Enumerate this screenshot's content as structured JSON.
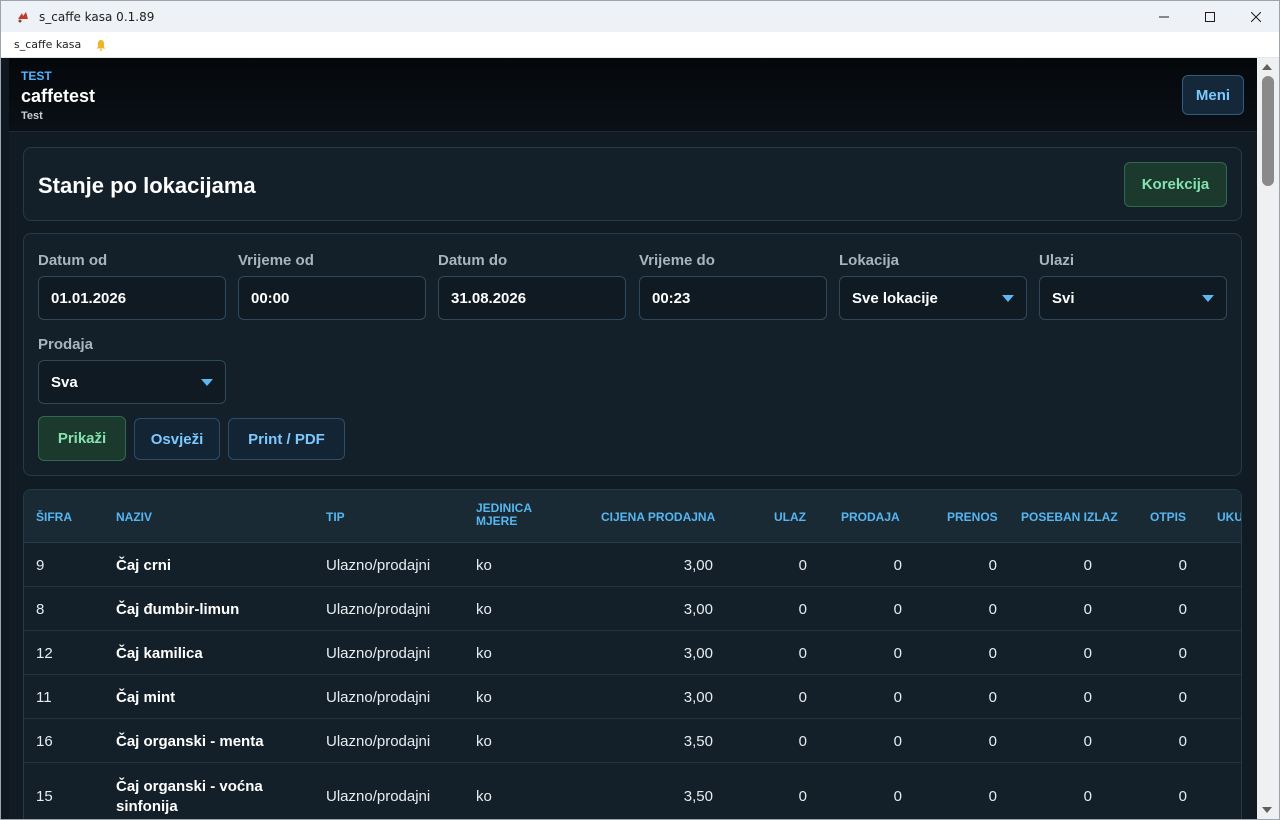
{
  "window": {
    "title": "s_caffe kasa 0.1.89",
    "menu_label": "s_caffe kasa"
  },
  "header": {
    "tenant_code": "TEST",
    "tenant_name": "caffetest",
    "tenant_sub": "Test",
    "menu_button": "Meni"
  },
  "page": {
    "title": "Stanje po lokacijama",
    "correction_button": "Korekcija"
  },
  "filters": {
    "date_from": {
      "label": "Datum od",
      "value": "01.01.2026"
    },
    "time_from": {
      "label": "Vrijeme od",
      "value": "00:00"
    },
    "date_to": {
      "label": "Datum do",
      "value": "31.08.2026"
    },
    "time_to": {
      "label": "Vrijeme do",
      "value": "00:23"
    },
    "location": {
      "label": "Lokacija",
      "value": "Sve lokacije"
    },
    "inputs": {
      "label": "Ulazi",
      "value": "Svi"
    },
    "sales": {
      "label": "Prodaja",
      "value": "Sva"
    }
  },
  "actions": {
    "show": "Prikaži",
    "refresh": "Osvježi",
    "print": "Print / PDF"
  },
  "table": {
    "columns": [
      "ŠIFRA",
      "NAZIV",
      "TIP",
      "JEDINICA MJERE",
      "CIJENA PRODAJNA",
      "ULAZ",
      "PRODAJA",
      "PRENOS",
      "POSEBAN IZLAZ",
      "OTPIS",
      "UKU"
    ],
    "rows": [
      {
        "sifra": "9",
        "naziv": "Čaj crni",
        "tip": "Ulazno/prodajni",
        "jm": "ko",
        "cijena": "3,00",
        "ulaz": "0",
        "prodaja": "0",
        "prenos": "0",
        "izlaz": "0",
        "otpis": "0"
      },
      {
        "sifra": "8",
        "naziv": "Čaj đumbir-limun",
        "tip": "Ulazno/prodajni",
        "jm": "ko",
        "cijena": "3,00",
        "ulaz": "0",
        "prodaja": "0",
        "prenos": "0",
        "izlaz": "0",
        "otpis": "0"
      },
      {
        "sifra": "12",
        "naziv": "Čaj kamilica",
        "tip": "Ulazno/prodajni",
        "jm": "ko",
        "cijena": "3,00",
        "ulaz": "0",
        "prodaja": "0",
        "prenos": "0",
        "izlaz": "0",
        "otpis": "0"
      },
      {
        "sifra": "11",
        "naziv": "Čaj mint",
        "tip": "Ulazno/prodajni",
        "jm": "ko",
        "cijena": "3,00",
        "ulaz": "0",
        "prodaja": "0",
        "prenos": "0",
        "izlaz": "0",
        "otpis": "0"
      },
      {
        "sifra": "16",
        "naziv": "Čaj organski - menta",
        "tip": "Ulazno/prodajni",
        "jm": "ko",
        "cijena": "3,50",
        "ulaz": "0",
        "prodaja": "0",
        "prenos": "0",
        "izlaz": "0",
        "otpis": "0"
      },
      {
        "sifra": "15",
        "naziv": "Čaj organski - voćna sinfonija",
        "tip": "Ulazno/prodajni",
        "jm": "ko",
        "cijena": "3,50",
        "ulaz": "0",
        "prodaja": "0",
        "prenos": "0",
        "izlaz": "0",
        "otpis": "0"
      }
    ]
  }
}
